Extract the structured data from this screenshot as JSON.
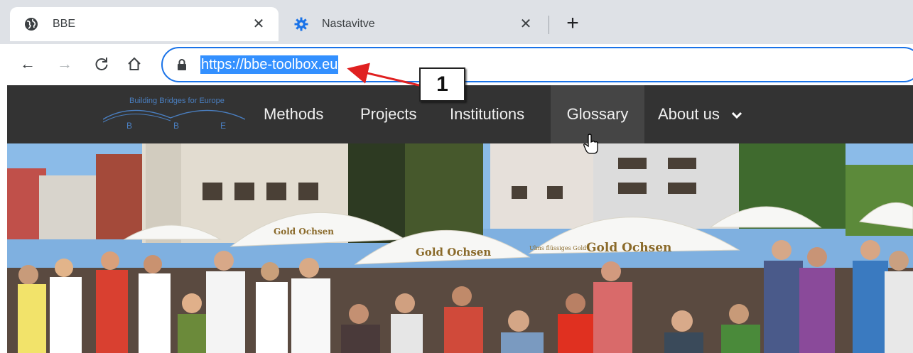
{
  "browser": {
    "tabs": [
      {
        "title": "BBE",
        "icon": "globe-icon",
        "active": true
      },
      {
        "title": "Nastavitve",
        "icon": "gear-icon",
        "active": false
      }
    ],
    "close_glyph": "✕",
    "new_tab_glyph": "+",
    "nav": {
      "back": "←",
      "forward": "→",
      "reload": "C",
      "home": "⌂"
    },
    "url": "https://bbe-toolbox.eu"
  },
  "site": {
    "logo": {
      "tagline": "Building Bridges for Europe",
      "letters": [
        "B",
        "B",
        "E"
      ]
    },
    "menu": [
      "Methods",
      "Projects",
      "Institutions",
      "Glossary",
      "About us"
    ]
  },
  "annotation": {
    "label": "1",
    "color": "#e02020"
  },
  "hero": {
    "umbrella_brand": "Gold Ochsen",
    "umbrella_small": "Ulms flüssiges Gold"
  },
  "colors": {
    "header_bg": "#333333",
    "hover_bg": "#454545",
    "accent": "#1a73e8",
    "logo_blue": "#4a7fc1"
  }
}
